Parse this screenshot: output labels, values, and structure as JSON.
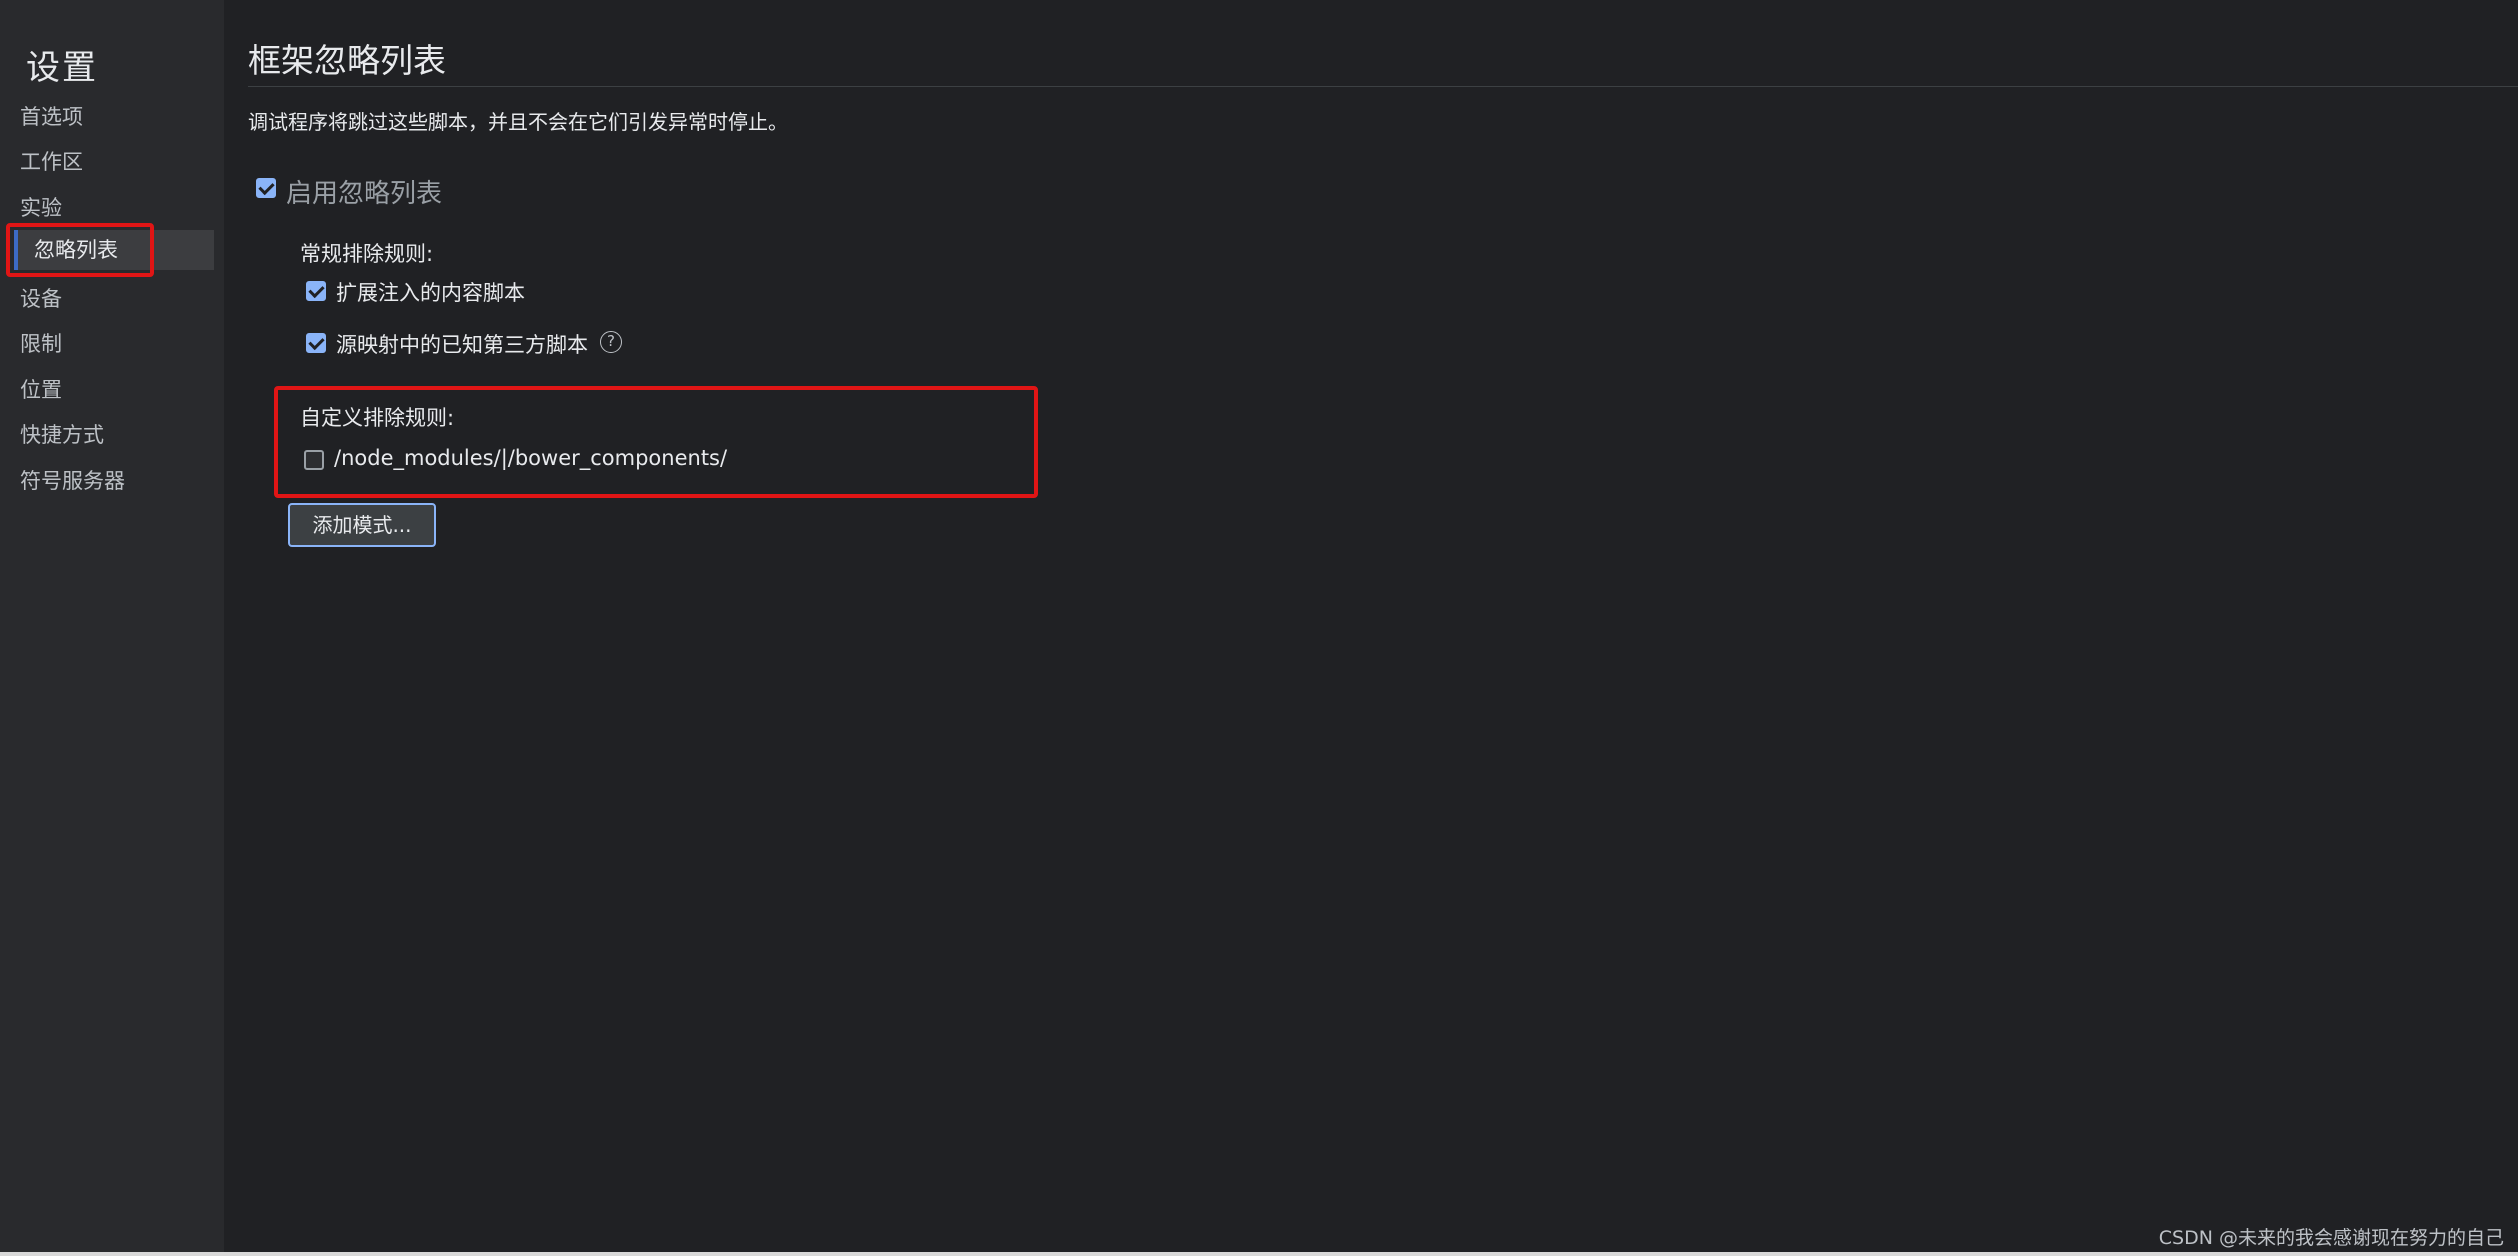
{
  "sidebar": {
    "title": "设置",
    "items": [
      {
        "label": "首选项"
      },
      {
        "label": "工作区"
      },
      {
        "label": "实验"
      },
      {
        "label": "忽略列表"
      },
      {
        "label": "设备"
      },
      {
        "label": "限制"
      },
      {
        "label": "位置"
      },
      {
        "label": "快捷方式"
      },
      {
        "label": "符号服务器"
      }
    ],
    "selected_index": 3
  },
  "main": {
    "title": "框架忽略列表",
    "description": "调试程序将跳过这些脚本，并且不会在它们引发异常时停止。",
    "enable": {
      "label": "启用忽略列表",
      "checked": true
    },
    "general_rules": {
      "label": "常规排除规则:",
      "options": [
        {
          "label": "扩展注入的内容脚本",
          "checked": true
        },
        {
          "label": "源映射中的已知第三方脚本",
          "checked": true
        }
      ],
      "help_icon_glyph": "?"
    },
    "custom_rules": {
      "label": "自定义排除规则:",
      "patterns": [
        {
          "pattern": "/node_modules/|/bower_components/",
          "checked": false
        }
      ]
    },
    "add_button_label": "添加模式..."
  },
  "watermark": "CSDN @未来的我会感谢现在努力的自己",
  "colors": {
    "accent": "#8ab4f8",
    "highlight_red": "#e01515",
    "background": "#202124",
    "sidebar_bg": "#292a2d"
  }
}
